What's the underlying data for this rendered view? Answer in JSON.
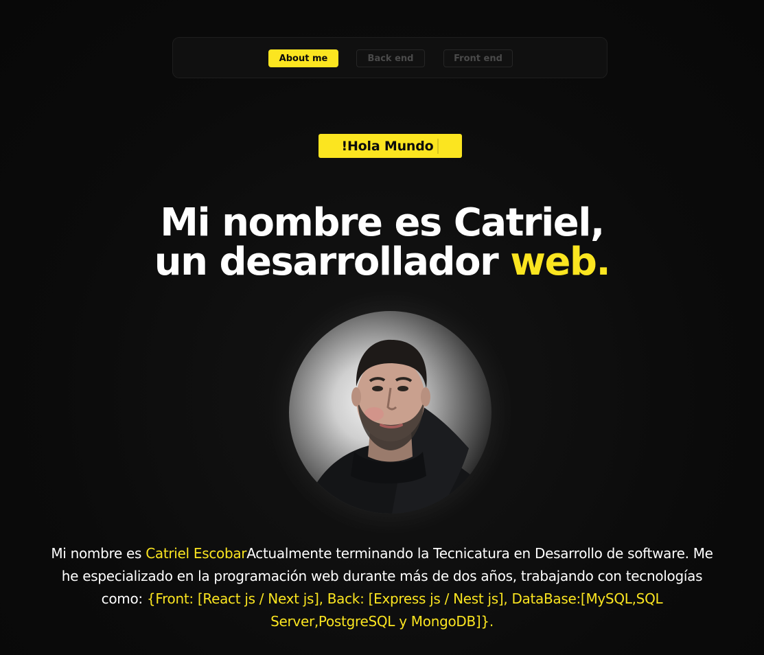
{
  "nav": {
    "tabs": [
      {
        "label": "About me",
        "active": true
      },
      {
        "label": "Back end",
        "active": false
      },
      {
        "label": "Front end",
        "active": false
      }
    ]
  },
  "hero": {
    "greeting": "!Hola Mundo",
    "title_line1": "Mi nombre es Catriel,",
    "title_line2_prefix": "un desarrollador ",
    "title_line2_accent": "web."
  },
  "profile": {
    "avatar_alt": "profile-photo"
  },
  "bio": {
    "intro": "Mi nombre es ",
    "name": "Catriel Escobar",
    "text": "Actualmente terminando la Tecnicatura en Desarrollo de software. Me he especializado en la programación web durante más de dos años, trabajando con tecnologías como: ",
    "tech": "{Front: [React js / Next js], Back: [Express js / Nest js], DataBase:[MySQL,SQL Server,PostgreSQL y MongoDB]}."
  },
  "colors": {
    "background": "#0b0b0b",
    "accent": "#fbe520",
    "text": "#ffffff",
    "muted": "#4a4a4a"
  }
}
